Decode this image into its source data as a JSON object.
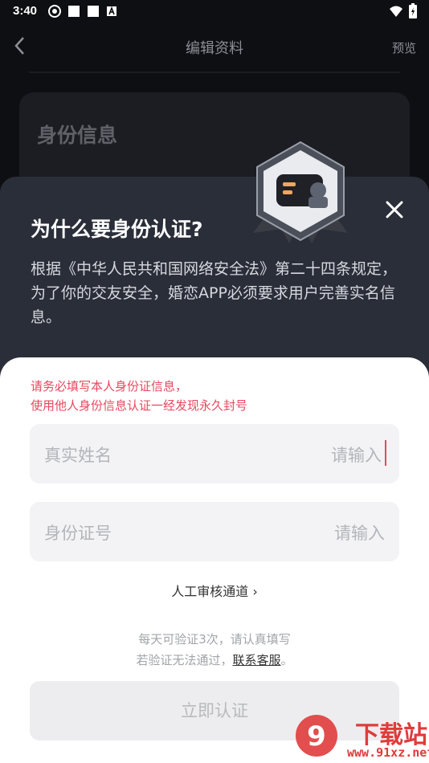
{
  "status_bar": {
    "time": "3:40"
  },
  "header": {
    "title": "编辑资料",
    "preview_label": "预览"
  },
  "background_card": {
    "title": "身份信息"
  },
  "modal": {
    "title": "为什么要身份认证?",
    "description": "根据《中华人民共和国网络安全法》第二十四条规定，为了你的交友安全，婚恋APP必须要求用户完善实名信息。"
  },
  "form": {
    "warning_line1": "请务必填写本人身份证信息，",
    "warning_line2": "使用他人身份信息认证一经发现永久封号",
    "name_label": "真实姓名",
    "name_placeholder": "请输入",
    "id_label": "身份证号",
    "id_placeholder": "请输入",
    "manual_review": "人工审核通道 ›",
    "hint_line1": "每天可验证3次，请认真填写",
    "hint_line2_prefix": "若验证无法通过，",
    "hint_link": "联系客服",
    "hint_line2_suffix": "。",
    "submit_label": "立即认证"
  },
  "watermark": {
    "text": "下载站",
    "url": "www.91xz.net",
    "logo": "9"
  },
  "colors": {
    "accent": "#e8475f",
    "sheet_dark": "#2a2e39",
    "background": "#0e0f12"
  }
}
